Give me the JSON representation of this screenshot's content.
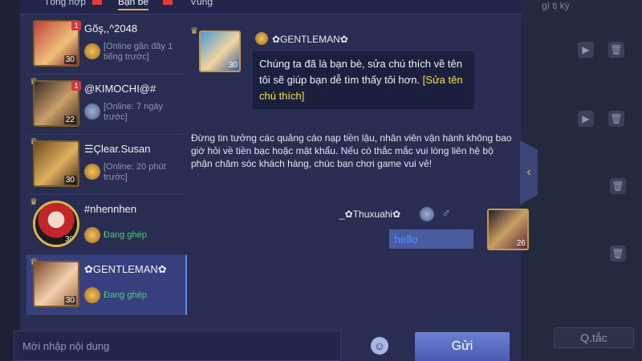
{
  "tabs": [
    {
      "label": "Tổng hợp"
    },
    {
      "label": "Bạn bè"
    },
    {
      "label": "Vùng"
    }
  ],
  "background_panel": {
    "tag": "gì tị kỳ",
    "rules_label": "Q.tắc"
  },
  "friends": [
    {
      "name": "Gõş,,^2048",
      "status": "[Online gần đây 1 tiếng trước]",
      "level": "30",
      "unread": "1",
      "status_color": "gray"
    },
    {
      "name": "@KIMOCHI@#",
      "status": "[Online: 7 ngày trước]",
      "level": "22",
      "unread": "1",
      "status_color": "gray"
    },
    {
      "name": "☰Çlear.Susan",
      "status": "[Online: 20 phút trước]",
      "level": "30",
      "unread": "",
      "status_color": "gray"
    },
    {
      "name": "#nhennhen",
      "status": "Đang ghép",
      "level": "30",
      "unread": "",
      "status_color": "green"
    },
    {
      "name": "✿GENTLEMAN✿",
      "status": "Đang ghép",
      "level": "30",
      "unread": "",
      "status_color": "green"
    }
  ],
  "chat": {
    "partner_name": "✿GENTLEMAN✿",
    "partner_level": "30",
    "partner_message": "Chúng ta đã là bạn bè, sửa chú thích về tên tôi sẽ giúp bạn dễ tìm thấy tôi hơn.",
    "partner_link": "[Sửa tên chú thích]",
    "notice": "Đừng tin tưởng các quảng cáo nạp tiền lậu, nhân viên vận hành không bao giờ hỏi về tiền bạc hoặc mật khẩu. Nếu có thắc mắc vui lòng liên hệ bộ phận chăm sóc khách hàng, chúc bạn chơi game vui vẻ!",
    "my_name": "_✿Thuxuahi✿",
    "my_gender": "♂",
    "my_message": "hello",
    "my_level": "26"
  },
  "input": {
    "placeholder": "Mời nhập nội dung"
  },
  "send_label": "Gửi"
}
